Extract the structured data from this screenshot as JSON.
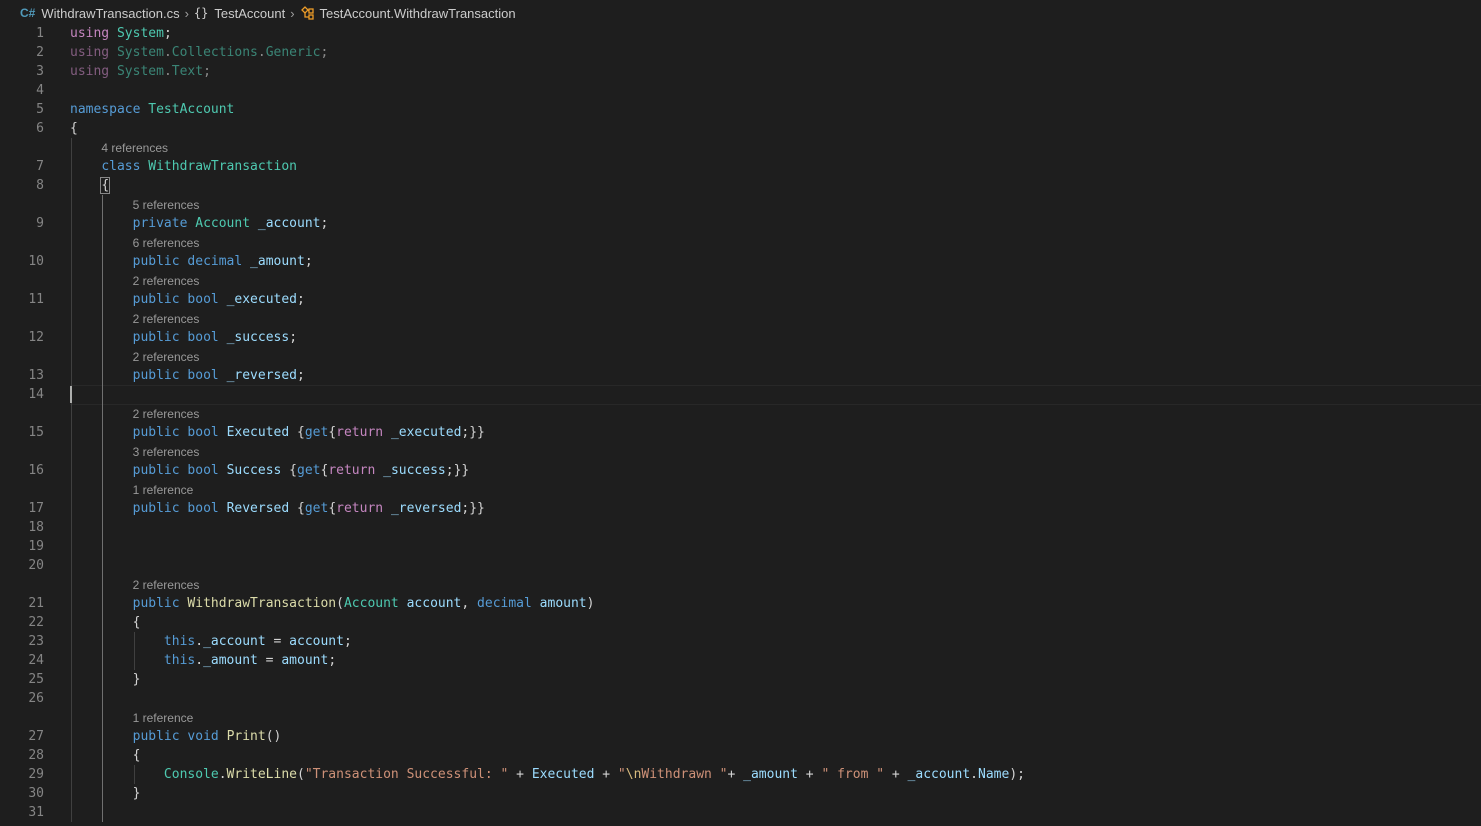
{
  "breadcrumb": {
    "file": "WithdrawTransaction.cs",
    "namespace": "TestAccount",
    "symbol": "TestAccount.WithdrawTransaction",
    "file_icon": "csharp-file-icon",
    "namespace_icon": "namespace-braces-icon",
    "class_icon": "class-icon"
  },
  "colors": {
    "keyword": "#569cd6",
    "control": "#c586c0",
    "type": "#4ec9b0",
    "function": "#dcdcaa",
    "variable": "#9cdcfe",
    "string": "#ce9178",
    "escape": "#d7ba7d",
    "text": "#d4d4d4",
    "line_number": "#858585",
    "codelens": "#999999",
    "background": "#1e1e1e"
  },
  "editor": {
    "cursor_line": "14",
    "lines": [
      {
        "n": "1",
        "tokens": [
          [
            "ctl",
            "using"
          ],
          [
            "pl",
            " "
          ],
          [
            "ty",
            "System"
          ],
          [
            "pl",
            ";"
          ]
        ]
      },
      {
        "n": "2",
        "tokens": [
          [
            "ctl dim",
            "using"
          ],
          [
            "pl dim",
            " "
          ],
          [
            "ty dim",
            "System"
          ],
          [
            "pl dim",
            "."
          ],
          [
            "ty dim",
            "Collections"
          ],
          [
            "pl dim",
            "."
          ],
          [
            "ty dim",
            "Generic"
          ],
          [
            "pl dim",
            ";"
          ]
        ]
      },
      {
        "n": "3",
        "tokens": [
          [
            "ctl dim",
            "using"
          ],
          [
            "pl dim",
            " "
          ],
          [
            "ty dim",
            "System"
          ],
          [
            "pl dim",
            "."
          ],
          [
            "ty dim",
            "Text"
          ],
          [
            "pl dim",
            ";"
          ]
        ]
      },
      {
        "n": "4",
        "tokens": []
      },
      {
        "n": "5",
        "tokens": [
          [
            "kw",
            "namespace"
          ],
          [
            "pl",
            " "
          ],
          [
            "ty",
            "TestAccount"
          ]
        ]
      },
      {
        "n": "6",
        "tokens": [
          [
            "pl",
            "{"
          ]
        ]
      },
      {
        "n": "7",
        "lens": "4 references",
        "tokens": [
          [
            "pl",
            "    "
          ],
          [
            "kw",
            "class"
          ],
          [
            "pl",
            " "
          ],
          [
            "ty",
            "WithdrawTransaction"
          ]
        ]
      },
      {
        "n": "8",
        "tokens": [
          [
            "pl",
            "    "
          ],
          [
            "pl bracket-box",
            "{"
          ]
        ]
      },
      {
        "n": "9",
        "lens": "5 references",
        "tokens": [
          [
            "pl",
            "        "
          ],
          [
            "kw",
            "private"
          ],
          [
            "pl",
            " "
          ],
          [
            "ty",
            "Account"
          ],
          [
            "pl",
            " "
          ],
          [
            "var",
            "_account"
          ],
          [
            "pl",
            ";"
          ]
        ]
      },
      {
        "n": "10",
        "lens": "6 references",
        "tokens": [
          [
            "pl",
            "        "
          ],
          [
            "kw",
            "public"
          ],
          [
            "pl",
            " "
          ],
          [
            "kw",
            "decimal"
          ],
          [
            "pl",
            " "
          ],
          [
            "var",
            "_amount"
          ],
          [
            "pl",
            ";"
          ]
        ]
      },
      {
        "n": "11",
        "lens": "2 references",
        "tokens": [
          [
            "pl",
            "        "
          ],
          [
            "kw",
            "public"
          ],
          [
            "pl",
            " "
          ],
          [
            "kw",
            "bool"
          ],
          [
            "pl",
            " "
          ],
          [
            "var",
            "_executed"
          ],
          [
            "pl",
            ";"
          ]
        ]
      },
      {
        "n": "12",
        "lens": "2 references",
        "tokens": [
          [
            "pl",
            "        "
          ],
          [
            "kw",
            "public"
          ],
          [
            "pl",
            " "
          ],
          [
            "kw",
            "bool"
          ],
          [
            "pl",
            " "
          ],
          [
            "var",
            "_success"
          ],
          [
            "pl",
            ";"
          ]
        ]
      },
      {
        "n": "13",
        "lens": "2 references",
        "tokens": [
          [
            "pl",
            "        "
          ],
          [
            "kw",
            "public"
          ],
          [
            "pl",
            " "
          ],
          [
            "kw",
            "bool"
          ],
          [
            "pl",
            " "
          ],
          [
            "var",
            "_reversed"
          ],
          [
            "pl",
            ";"
          ]
        ]
      },
      {
        "n": "14",
        "tokens": []
      },
      {
        "n": "15",
        "lens": "2 references",
        "tokens": [
          [
            "pl",
            "        "
          ],
          [
            "kw",
            "public"
          ],
          [
            "pl",
            " "
          ],
          [
            "kw",
            "bool"
          ],
          [
            "pl",
            " "
          ],
          [
            "var",
            "Executed"
          ],
          [
            "pl",
            " {"
          ],
          [
            "kw",
            "get"
          ],
          [
            "pl",
            "{"
          ],
          [
            "ctl",
            "return"
          ],
          [
            "pl",
            " "
          ],
          [
            "var",
            "_executed"
          ],
          [
            "pl",
            ";}}"
          ]
        ]
      },
      {
        "n": "16",
        "lens": "3 references",
        "tokens": [
          [
            "pl",
            "        "
          ],
          [
            "kw",
            "public"
          ],
          [
            "pl",
            " "
          ],
          [
            "kw",
            "bool"
          ],
          [
            "pl",
            " "
          ],
          [
            "var",
            "Success"
          ],
          [
            "pl",
            " {"
          ],
          [
            "kw",
            "get"
          ],
          [
            "pl",
            "{"
          ],
          [
            "ctl",
            "return"
          ],
          [
            "pl",
            " "
          ],
          [
            "var",
            "_success"
          ],
          [
            "pl",
            ";}}"
          ]
        ]
      },
      {
        "n": "17",
        "lens": "1 reference",
        "tokens": [
          [
            "pl",
            "        "
          ],
          [
            "kw",
            "public"
          ],
          [
            "pl",
            " "
          ],
          [
            "kw",
            "bool"
          ],
          [
            "pl",
            " "
          ],
          [
            "var",
            "Reversed"
          ],
          [
            "pl",
            " {"
          ],
          [
            "kw",
            "get"
          ],
          [
            "pl",
            "{"
          ],
          [
            "ctl",
            "return"
          ],
          [
            "pl",
            " "
          ],
          [
            "var",
            "_reversed"
          ],
          [
            "pl",
            ";}}"
          ]
        ]
      },
      {
        "n": "18",
        "tokens": []
      },
      {
        "n": "19",
        "tokens": []
      },
      {
        "n": "20",
        "tokens": []
      },
      {
        "n": "21",
        "lens": "2 references",
        "tokens": [
          [
            "pl",
            "        "
          ],
          [
            "kw",
            "public"
          ],
          [
            "pl",
            " "
          ],
          [
            "fn",
            "WithdrawTransaction"
          ],
          [
            "pl",
            "("
          ],
          [
            "ty",
            "Account"
          ],
          [
            "pl",
            " "
          ],
          [
            "var",
            "account"
          ],
          [
            "pl",
            ", "
          ],
          [
            "kw",
            "decimal"
          ],
          [
            "pl",
            " "
          ],
          [
            "var",
            "amount"
          ],
          [
            "pl",
            ")"
          ]
        ]
      },
      {
        "n": "22",
        "tokens": [
          [
            "pl",
            "        {"
          ]
        ]
      },
      {
        "n": "23",
        "tokens": [
          [
            "pl",
            "            "
          ],
          [
            "kw",
            "this"
          ],
          [
            "pl",
            "."
          ],
          [
            "var",
            "_account"
          ],
          [
            "pl",
            " = "
          ],
          [
            "var",
            "account"
          ],
          [
            "pl",
            ";"
          ]
        ]
      },
      {
        "n": "24",
        "tokens": [
          [
            "pl",
            "            "
          ],
          [
            "kw",
            "this"
          ],
          [
            "pl",
            "."
          ],
          [
            "var",
            "_amount"
          ],
          [
            "pl",
            " = "
          ],
          [
            "var",
            "amount"
          ],
          [
            "pl",
            ";"
          ]
        ]
      },
      {
        "n": "25",
        "tokens": [
          [
            "pl",
            "        }"
          ]
        ]
      },
      {
        "n": "26",
        "tokens": []
      },
      {
        "n": "27",
        "lens": "1 reference",
        "tokens": [
          [
            "pl",
            "        "
          ],
          [
            "kw",
            "public"
          ],
          [
            "pl",
            " "
          ],
          [
            "kw",
            "void"
          ],
          [
            "pl",
            " "
          ],
          [
            "fn",
            "Print"
          ],
          [
            "pl",
            "()"
          ]
        ]
      },
      {
        "n": "28",
        "tokens": [
          [
            "pl",
            "        {"
          ]
        ]
      },
      {
        "n": "29",
        "tokens": [
          [
            "pl",
            "            "
          ],
          [
            "ty",
            "Console"
          ],
          [
            "pl",
            "."
          ],
          [
            "fn",
            "WriteLine"
          ],
          [
            "pl",
            "("
          ],
          [
            "str",
            "\"Transaction Successful: \""
          ],
          [
            "pl",
            " + "
          ],
          [
            "var",
            "Executed"
          ],
          [
            "pl",
            " + "
          ],
          [
            "str",
            "\""
          ],
          [
            "esc",
            "\\n"
          ],
          [
            "str",
            "Withdrawn \""
          ],
          [
            "pl",
            "+ "
          ],
          [
            "var",
            "_amount"
          ],
          [
            "pl",
            " + "
          ],
          [
            "str",
            "\" from \""
          ],
          [
            "pl",
            " + "
          ],
          [
            "var",
            "_account"
          ],
          [
            "pl",
            "."
          ],
          [
            "var",
            "Name"
          ],
          [
            "pl",
            ");"
          ]
        ]
      },
      {
        "n": "30",
        "tokens": [
          [
            "pl",
            "        }"
          ]
        ]
      },
      {
        "n": "31",
        "tokens": []
      }
    ]
  }
}
